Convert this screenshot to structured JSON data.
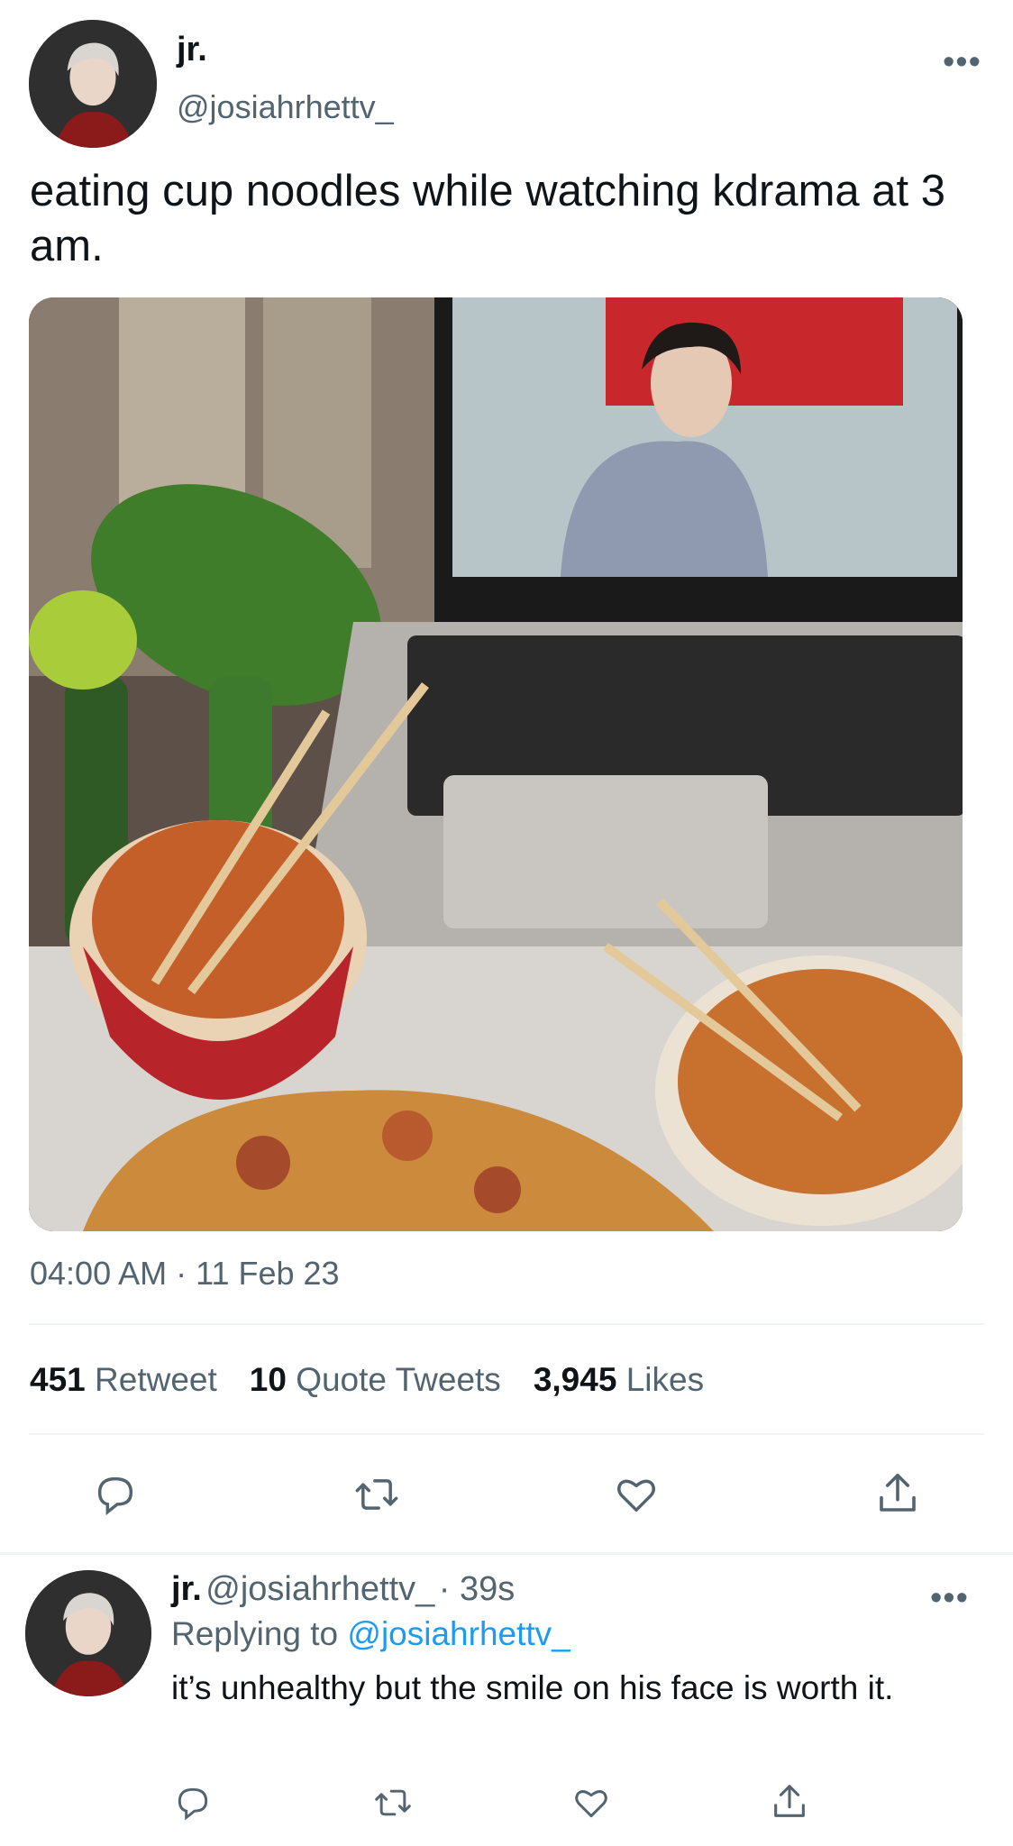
{
  "tweet": {
    "author_name": "jr.",
    "author_handle": "@josiahrhettv_",
    "text": "eating cup noodles while watching kdrama at 3 am.",
    "time": "04:00 AM",
    "date_sep": " · ",
    "date": "11 Feb 23",
    "stats": {
      "retweets_count": "451",
      "retweets_label": "Retweet",
      "quotes_count": "10",
      "quotes_label": "Quote Tweets",
      "likes_count": "3,945",
      "likes_label": "Likes"
    },
    "more_label": "•••"
  },
  "reply": {
    "author_name": "jr.",
    "author_handle": "@josiahrhettv_",
    "age": "· 39s",
    "replying_prefix": "Replying to",
    "replying_handle": "@josiahrhettv_",
    "text": "it’s unhealthy but the smile on his face is worth it.",
    "more_label": "•••"
  },
  "icons": [
    "reply-icon",
    "retweet-icon",
    "like-icon",
    "share-icon",
    "more-icon"
  ],
  "colors": {
    "text": "#0f1419",
    "secondary": "#536471",
    "link": "#1d9bf0",
    "divider": "#eff3f4"
  }
}
